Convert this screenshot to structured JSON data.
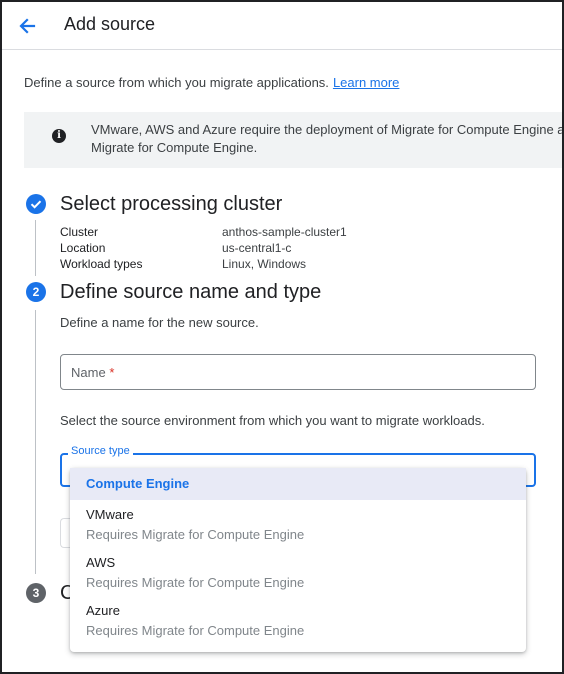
{
  "header": {
    "title": "Add source"
  },
  "intro": {
    "text": "Define a source from which you migrate applications.",
    "link": "Learn more"
  },
  "banner": {
    "icon": "info-icon",
    "line1": "VMware, AWS and Azure require the deployment of Migrate for Compute Engine an",
    "line2": "Migrate for Compute Engine."
  },
  "steps": {
    "step1": {
      "title": "Select processing cluster",
      "details": [
        {
          "label": "Cluster",
          "value": "anthos-sample-cluster1"
        },
        {
          "label": "Location",
          "value": "us-central1-c"
        },
        {
          "label": "Workload types",
          "value": "Linux, Windows"
        }
      ]
    },
    "step2": {
      "number": "2",
      "title": "Define source name and type",
      "name_help": "Define a name for the new source.",
      "name_field": {
        "label": "Name",
        "required_mark": "*",
        "value": ""
      },
      "type_help": "Select the source environment from which you want to migrate workloads.",
      "source_type": {
        "label": "Source type"
      }
    },
    "step3": {
      "number": "3",
      "title_visible": "C"
    }
  },
  "dropdown": {
    "options": [
      {
        "label": "Compute Engine",
        "sub": "",
        "selected": true
      },
      {
        "label": "VMware",
        "sub": "Requires Migrate for Compute Engine",
        "selected": false
      },
      {
        "label": "AWS",
        "sub": "Requires Migrate for Compute Engine",
        "selected": false
      },
      {
        "label": "Azure",
        "sub": "Requires Migrate for Compute Engine",
        "selected": false
      }
    ]
  },
  "colors": {
    "accent": "#1a73e8",
    "selected_bg": "#e8eaf6",
    "muted": "#80868b"
  }
}
